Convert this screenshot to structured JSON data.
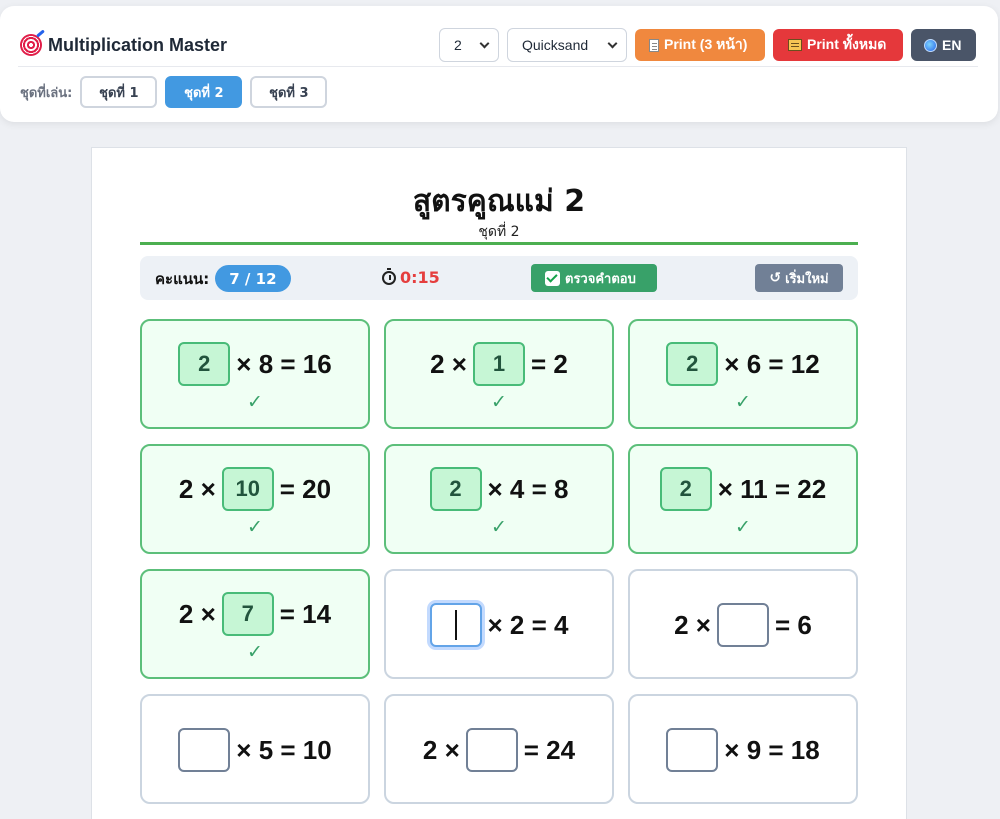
{
  "app": {
    "title": "Multiplication Master",
    "table_select_value": "2",
    "font_select_value": "Quicksand",
    "print_pages_label": "Print (3 หน้า)",
    "print_all_label": "Print ทั้งหมด",
    "language_label": "EN"
  },
  "sets": {
    "label": "ชุดที่เล่น:",
    "tabs": [
      {
        "label": "ชุดที่ 1",
        "active": false
      },
      {
        "label": "ชุดที่ 2",
        "active": true
      },
      {
        "label": "ชุดที่ 3",
        "active": false
      }
    ]
  },
  "sheet": {
    "title": "สูตรคูณแม่ 2",
    "subtitle": "ชุดที่ 2"
  },
  "status": {
    "score_label": "คะแนน:",
    "score_value": "7 / 12",
    "timer": "0:15",
    "check_label": "ตรวจคำตอบ",
    "reset_label": "เริ่มใหม่"
  },
  "colors": {
    "accent_blue": "#4299e1",
    "correct_green": "#38a169",
    "print_orange": "#f0883e",
    "print_red": "#e5383b",
    "timer_red": "#e53e3e"
  },
  "problems": [
    {
      "parts": [
        "",
        "× 8 = 16"
      ],
      "answer": "2",
      "state": "correct"
    },
    {
      "parts": [
        "2 ×",
        "= 2"
      ],
      "answer": "1",
      "state": "correct"
    },
    {
      "parts": [
        "",
        "× 6 = 12"
      ],
      "answer": "2",
      "state": "correct"
    },
    {
      "parts": [
        "2 ×",
        "= 20"
      ],
      "answer": "10",
      "state": "correct"
    },
    {
      "parts": [
        "",
        "× 4 = 8"
      ],
      "answer": "2",
      "state": "correct"
    },
    {
      "parts": [
        "",
        "× 11 = 22"
      ],
      "answer": "2",
      "state": "correct"
    },
    {
      "parts": [
        "2 ×",
        "= 14"
      ],
      "answer": "7",
      "state": "correct"
    },
    {
      "parts": [
        "",
        "× 2 = 4"
      ],
      "answer": "",
      "state": "focused"
    },
    {
      "parts": [
        "2 ×",
        "= 6"
      ],
      "answer": "",
      "state": "blank"
    },
    {
      "parts": [
        "",
        "× 5 = 10"
      ],
      "answer": "",
      "state": "blank"
    },
    {
      "parts": [
        "2 ×",
        "= 24"
      ],
      "answer": "",
      "state": "blank"
    },
    {
      "parts": [
        "",
        "× 9 = 18"
      ],
      "answer": "",
      "state": "blank"
    }
  ],
  "tick_mark": "✓"
}
